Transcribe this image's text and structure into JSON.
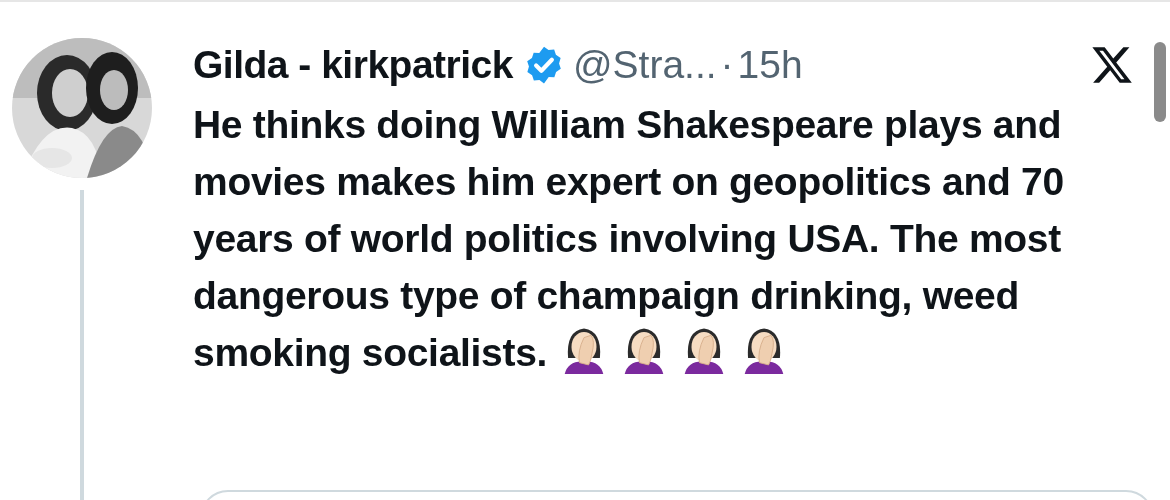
{
  "post": {
    "author": "Gilda - kirkpatrick",
    "verified": true,
    "handle": "@Stra...",
    "separator": "·",
    "time": "15h",
    "text": "He thinks doing William Shakespeare plays and movies makes him expert on geopolitics and 70 years of world politics involving USA. The most dangerous type of champaign drinking, weed smoking socialists.",
    "emojis": [
      {
        "kind": "facepalm"
      },
      {
        "kind": "facepalm"
      },
      {
        "kind": "facepalm"
      },
      {
        "kind": "facepalm"
      }
    ],
    "quoted_card": {
      "kind": "card"
    }
  }
}
